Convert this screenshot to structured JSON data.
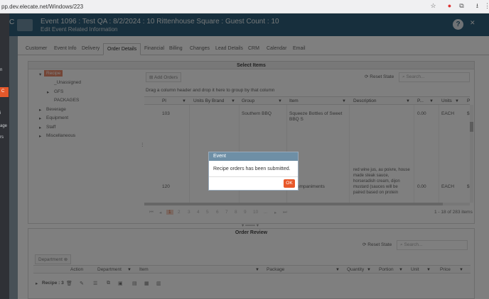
{
  "browser": {
    "url": "pp.dev.elecate.net/Windows/223"
  },
  "sidebar": {
    "items": [
      "n",
      "C",
      "i",
      "age",
      "rs"
    ]
  },
  "header": {
    "logo_letter": "C",
    "title": "Event 1096 : Test QA : 8/2/2024 : 10 Rittenhouse Square : Guest Count : 10",
    "subtitle": "Edit Event Related Information",
    "help": "?"
  },
  "tabs": [
    "Customer",
    "Event Info",
    "Delivery",
    "Order Details",
    "Financial",
    "Billing",
    "Changes",
    "Lead Details",
    "CRM",
    "Calendar",
    "Email"
  ],
  "select_items": {
    "title": "Select Items",
    "tree": {
      "recipe": "Recipe",
      "unassigned": "_Unassigned",
      "gfs": "GFS",
      "packages": "PACKAGES",
      "beverage": "Beverage",
      "equipment": "Equipment",
      "staff": "Staff",
      "miscellaneous": "Miscellaneous"
    },
    "add_orders": "Add Orders",
    "reset_state": "Reset State",
    "search_placeholder": "Search...",
    "group_hint": "Drag a column header and drop it here to group by that column",
    "columns": {
      "pl": "Pl",
      "units_by_brand": "Units By Brand",
      "group": "Group",
      "item": "Item",
      "description": "Description",
      "p": "P...",
      "units": "Units",
      "p2": "P"
    },
    "rows": [
      {
        "pl": "103",
        "group": "Southern BBQ",
        "item": "Squeeze Bottles of Sweet BBQ S",
        "p": "0.00",
        "units": "EACH",
        "dollar": "$"
      },
      {
        "pl": "120",
        "item": "Accompaniments",
        "description": "red wine jus, au poivre, house made steak sauce, horseradish cream, dijon mustard (sauces will be paired based on protein",
        "p": "0.00",
        "units": "EACH",
        "dollar": "$"
      }
    ],
    "pagination": {
      "pages": [
        "1",
        "2",
        "3",
        "4",
        "5",
        "6",
        "7",
        "8",
        "9",
        "10",
        "..."
      ],
      "summary": "1 - 18 of 283 items"
    }
  },
  "order_review": {
    "title": "Order Review",
    "reset_state": "Reset State",
    "search_placeholder": "Search...",
    "group_chip": "Department",
    "columns": {
      "action": "Action",
      "department": "Department",
      "item": "Item",
      "package": "Package",
      "quantity": "Quantity",
      "portion": "Portion",
      "unit": "Unit",
      "price": "Price"
    },
    "group_row": "Recipe : 3"
  },
  "dialog": {
    "title": "Event",
    "message": "Recipe orders has been submitted.",
    "ok": "OK"
  }
}
